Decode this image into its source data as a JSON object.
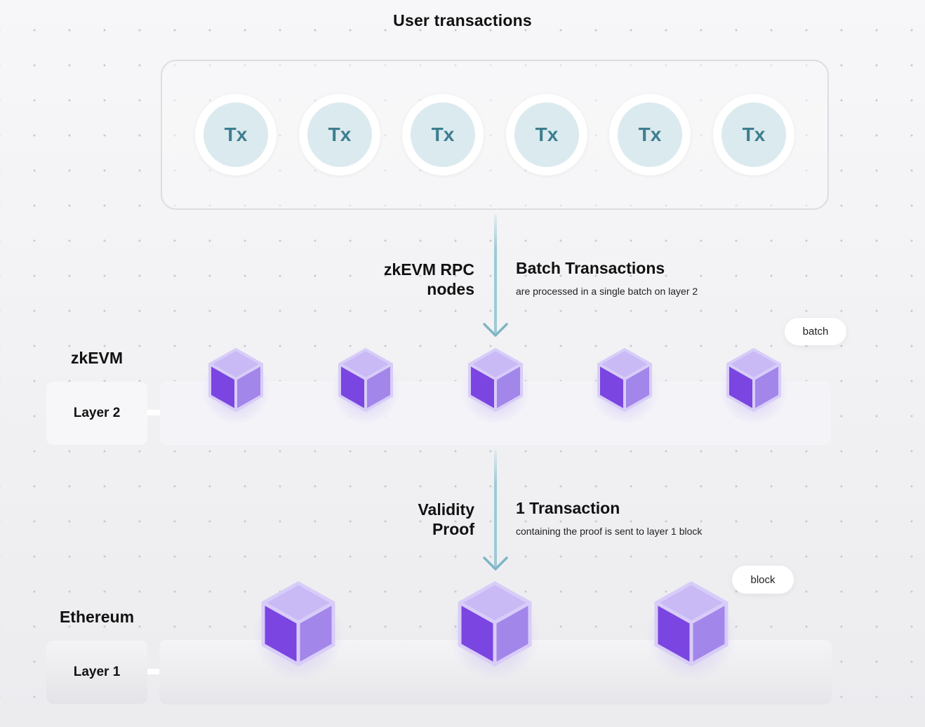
{
  "title": "User transactions",
  "transactions": [
    "Tx",
    "Tx",
    "Tx",
    "Tx",
    "Tx",
    "Tx"
  ],
  "rpc": {
    "label_line1": "zkEVM RPC",
    "label_line2": "nodes",
    "info_title": "Batch Transactions",
    "info_sub": "are processed in a single batch on layer 2"
  },
  "layer2": {
    "chain_name": "zkEVM",
    "layer_label": "Layer 2",
    "tag": "batch",
    "cube_count": 5
  },
  "proof": {
    "label_line1": "Validity",
    "label_line2": "Proof",
    "info_title": "1 Transaction",
    "info_sub": "containing the proof is sent to layer 1 block"
  },
  "layer1": {
    "chain_name": "Ethereum",
    "layer_label": "Layer 1",
    "tag": "block",
    "cube_count": 3
  },
  "colors": {
    "tx_fill": "#dbeaee",
    "tx_text": "#3d7e8f",
    "arrow": "#7fb5c4",
    "cube_top": "#c9b9f5",
    "cube_left": "#7a45e0",
    "cube_right": "#a386ea"
  }
}
